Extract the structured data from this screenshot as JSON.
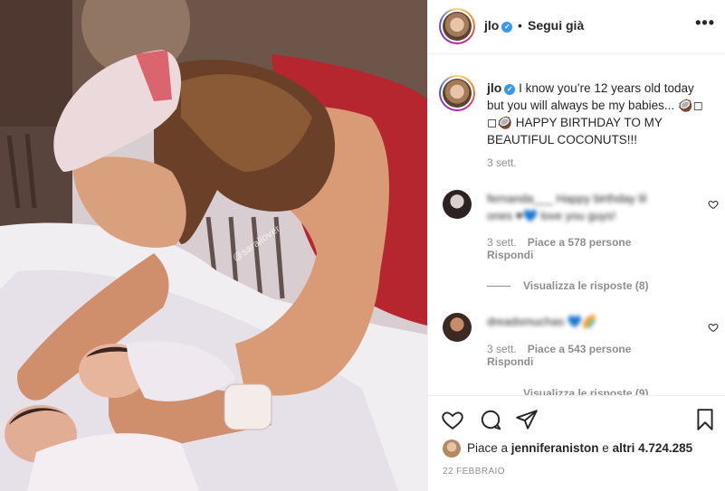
{
  "photo": {
    "watermark": "@sarallover"
  },
  "header": {
    "username": "jlo",
    "dot": "•",
    "follow_label": "Segui già",
    "more_label": "•••"
  },
  "caption": {
    "username": "jlo",
    "text": "I know you’re 12 years old today but you will always be my babies... 🥥◻ ◻🥥 HAPPY BIRTHDAY TO MY BEAUTIFUL COCONUTS!!!",
    "time": "3 sett."
  },
  "comments": [
    {
      "blurred_text": "fernanda___ Happy birthday lil ones ♥💙 love you guys!",
      "time": "3 sett.",
      "likes_label": "Piace a 578 persone",
      "reply_label": "Rispondi",
      "view_replies": "Visualizza le risposte (8)"
    },
    {
      "blurred_text": "dreadsmuchas 💙🌈",
      "time": "3 sett.",
      "likes_label": "Piace a 543 persone",
      "reply_label": "Rispondi",
      "view_replies": "Visualizza le risposte (9)"
    }
  ],
  "footer": {
    "likes_prefix": "Piace a ",
    "likes_user": "jenniferaniston",
    "likes_middle": " e ",
    "likes_others": "altri 4.724.285",
    "date": "22 FEBBRAIO"
  }
}
